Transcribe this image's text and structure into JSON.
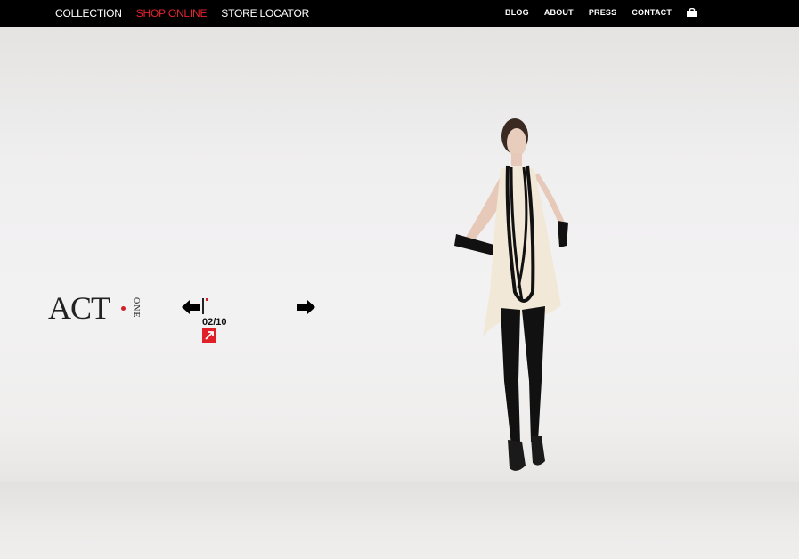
{
  "nav": {
    "main": [
      {
        "label": "COLLECTION",
        "active": false
      },
      {
        "label": "SHOP ONLINE",
        "active": true
      },
      {
        "label": "STORE LOCATOR",
        "active": false
      }
    ],
    "secondary": [
      {
        "label": "BLOG"
      },
      {
        "label": "ABOUT"
      },
      {
        "label": "PRESS"
      },
      {
        "label": "CONTACT"
      }
    ],
    "cart_icon": "shopping-bag-icon"
  },
  "logo": {
    "main": "ACT",
    "sub": "ONE"
  },
  "slideshow": {
    "counter": "02/10",
    "current": 2,
    "total": 10,
    "prev_icon": "arrow-left-icon",
    "next_icon": "arrow-right-icon",
    "expand_icon": "expand-arrow-icon"
  },
  "colors": {
    "accent": "#e5232b",
    "topbar": "#000000",
    "background": "#ecebea"
  }
}
